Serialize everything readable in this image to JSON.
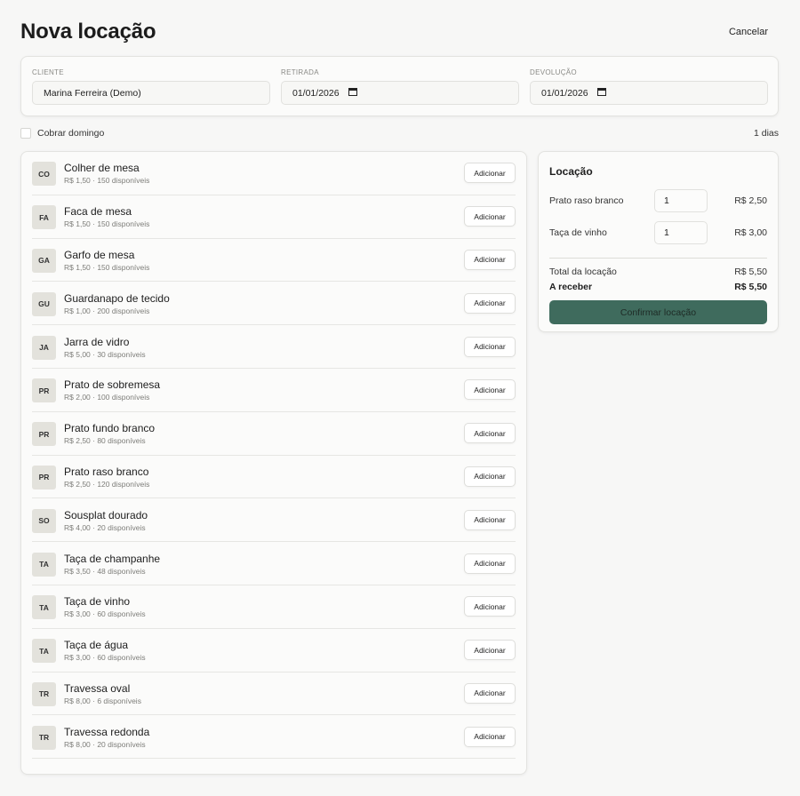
{
  "header": {
    "title": "Nova locação",
    "cancel_label": "Cancelar"
  },
  "form": {
    "cliente_label": "CLIENTE",
    "cliente_value": "Marina Ferreira (Demo)",
    "retirada_label": "RETIRADA",
    "retirada_value": "01/01/2026",
    "devolucao_label": "DEVOLUÇÃO",
    "devolucao_value": "01/01/2026",
    "calendar_icon": "calendar-icon"
  },
  "options": {
    "cobrar_domingo_label": "Cobrar domingo",
    "cobrar_domingo_checked": false,
    "days_text": "1 dias"
  },
  "items": [
    {
      "abbr": "CO",
      "name": "Colher de mesa",
      "meta": "R$ 1,50 · 150 disponíveis",
      "button": "Adicionar"
    },
    {
      "abbr": "FA",
      "name": "Faca de mesa",
      "meta": "R$ 1,50 · 150 disponíveis",
      "button": "Adicionar"
    },
    {
      "abbr": "GA",
      "name": "Garfo de mesa",
      "meta": "R$ 1,50 · 150 disponíveis",
      "button": "Adicionar"
    },
    {
      "abbr": "GU",
      "name": "Guardanapo de tecido",
      "meta": "R$ 1,00 · 200 disponíveis",
      "button": "Adicionar"
    },
    {
      "abbr": "JA",
      "name": "Jarra de vidro",
      "meta": "R$ 5,00 · 30 disponíveis",
      "button": "Adicionar"
    },
    {
      "abbr": "PR",
      "name": "Prato de sobremesa",
      "meta": "R$ 2,00 · 100 disponíveis",
      "button": "Adicionar"
    },
    {
      "abbr": "PR",
      "name": "Prato fundo branco",
      "meta": "R$ 2,50 · 80 disponíveis",
      "button": "Adicionar"
    },
    {
      "abbr": "PR",
      "name": "Prato raso branco",
      "meta": "R$ 2,50 · 120 disponíveis",
      "button": "Adicionar"
    },
    {
      "abbr": "SO",
      "name": "Sousplat dourado",
      "meta": "R$ 4,00 · 20 disponíveis",
      "button": "Adicionar"
    },
    {
      "abbr": "TA",
      "name": "Taça de champanhe",
      "meta": "R$ 3,50 · 48 disponíveis",
      "button": "Adicionar"
    },
    {
      "abbr": "TA",
      "name": "Taça de vinho",
      "meta": "R$ 3,00 · 60 disponíveis",
      "button": "Adicionar"
    },
    {
      "abbr": "TA",
      "name": "Taça de água",
      "meta": "R$ 3,00 · 60 disponíveis",
      "button": "Adicionar"
    },
    {
      "abbr": "TR",
      "name": "Travessa oval",
      "meta": "R$ 8,00 · 6 disponíveis",
      "button": "Adicionar"
    },
    {
      "abbr": "TR",
      "name": "Travessa redonda",
      "meta": "R$ 8,00 · 20 disponíveis",
      "button": "Adicionar"
    }
  ],
  "summary": {
    "title": "Locação",
    "lines": [
      {
        "name": "Prato raso branco",
        "qty": "1",
        "price": "R$ 2,50"
      },
      {
        "name": "Taça de vinho",
        "qty": "1",
        "price": "R$ 3,00"
      }
    ],
    "total_label": "Total da locação",
    "total_value": "R$ 5,50",
    "receber_label": "A receber",
    "receber_value": "R$ 5,50",
    "confirm_label": "Confirmar locação",
    "accent_color": "#3f6b5d"
  }
}
